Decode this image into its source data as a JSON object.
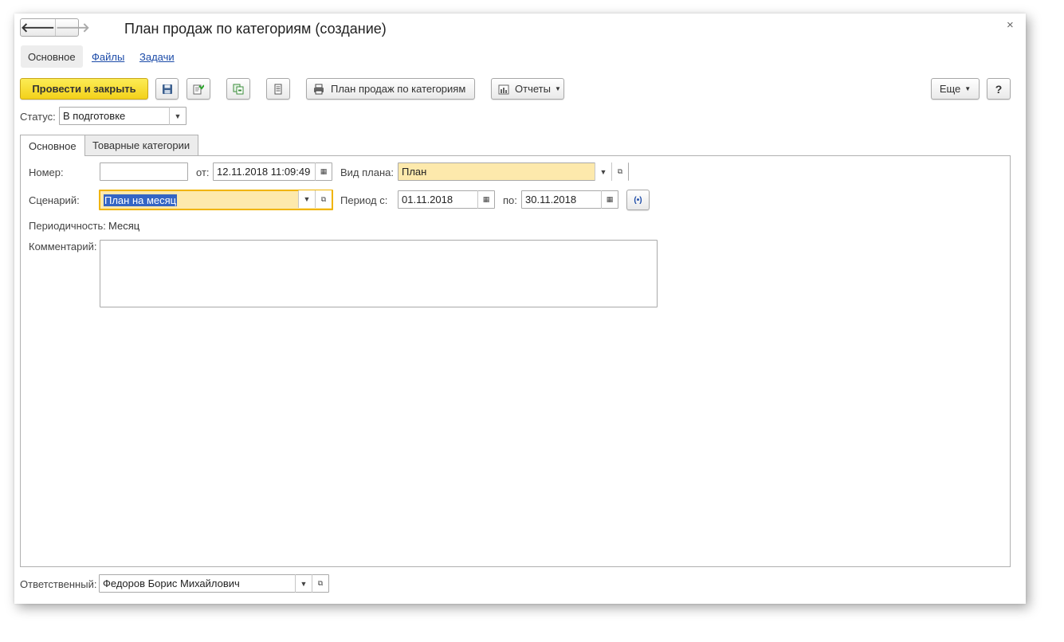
{
  "window": {
    "title": "План продаж по категориям (создание)",
    "close": "×"
  },
  "nav": {
    "back": "🡐",
    "forward": "🡒"
  },
  "sections": [
    "Основное",
    "Файлы",
    "Задачи"
  ],
  "toolbar": {
    "post_close": "Провести и закрыть",
    "print_label": "План продаж по категориям",
    "reports_label": "Отчеты",
    "more_label": "Еще",
    "help_label": "?"
  },
  "status": {
    "label": "Статус:",
    "value": "В подготовке"
  },
  "tabs": [
    "Основное",
    "Товарные категории"
  ],
  "form": {
    "number_label": "Номер:",
    "number_value": "",
    "date_label": "от:",
    "date_value": "12.11.2018 11:09:49",
    "plan_kind_label": "Вид плана:",
    "plan_kind_value": "План",
    "scenario_label": "Сценарий:",
    "scenario_value": "План на месяц",
    "period_from_label": "Период с:",
    "period_from_value": "01.11.2018",
    "period_to_label": "по:",
    "period_to_value": "30.11.2018",
    "periodicity_label": "Периодичность:",
    "periodicity_value": "Месяц",
    "comment_label": "Комментарий:",
    "comment_value": ""
  },
  "footer": {
    "responsible_label": "Ответственный:",
    "responsible_value": "Федоров Борис Михайлович"
  },
  "colors": {
    "primary": "#f5d324",
    "yellow_field": "#fde9ac",
    "focus": "#f0b400",
    "selection": "#3465c4",
    "link": "#1c4ba8"
  }
}
